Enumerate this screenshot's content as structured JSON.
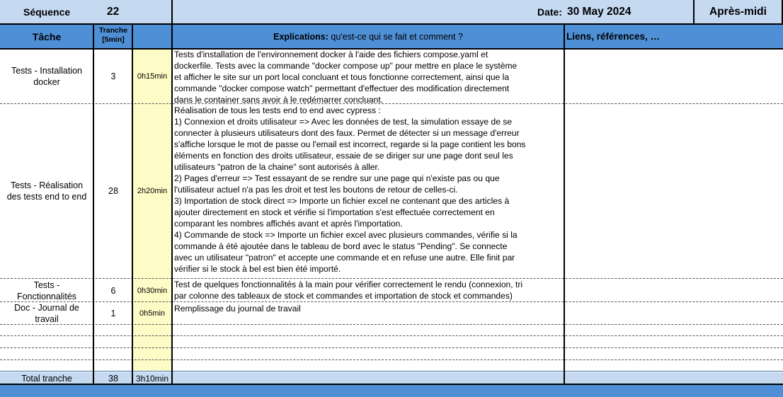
{
  "title_row": {
    "sequence_label": "Séquence",
    "sequence_value": "22",
    "date_label": "Date:",
    "date_value": "30 May 2024",
    "period": "Après-midi"
  },
  "headers": {
    "task": "Tâche",
    "tranche_line1": "Tranche",
    "tranche_line2": "[5min]",
    "explications_bold": "Explications:",
    "explications_rest": " qu'est-ce qui se fait et comment ?",
    "links": "Liens, références, …"
  },
  "rows": [
    {
      "task_lines": [
        "Tests - Installation",
        "docker"
      ],
      "tranche": "3",
      "duration": "0h15min",
      "lines": [
        "Tests d'installation de l'environnement docker à l'aide des fichiers compose.yaml et",
        "dockerfile. Tests avec la commande \"docker compose up\" pour mettre en place le système",
        "et afficher le site sur un port local concluant et tous fonctionne correctement, ainsi que la",
        "commande \"docker compose watch\" permettant d'effectuer des modification directement",
        "dans le container sans avoir à le redémarrer concluant."
      ]
    },
    {
      "task_lines": [
        "Tests - Réalisation",
        "des tests end to end"
      ],
      "tranche": "28",
      "duration": "2h20min",
      "lines": [
        "Réalisation de tous les tests end to end avec cypress :",
        "1) Connexion et droits utilisateur => Avec les données de test, la simulation essaye de se",
        "connecter à plusieurs utilisateurs dont des faux. Permet de détecter si un message d'erreur",
        "s'affiche lorsque le mot de passe ou l'email est incorrect, regarde si la page contient les bons",
        "éléments en fonction des droits utilisateur, essaie de se diriger sur une page dont seul les",
        "utilisateurs \"patron de la chaine\" sont autorisés à aller.",
        "2) Pages d'erreur => Test essayant de se rendre sur une page qui n'existe pas ou que",
        "l'utilisateur actuel n'a pas les droit et test les boutons de retour de celles-ci.",
        "3) Importation de stock direct => Importe un fichier excel ne contenant que des articles à",
        "ajouter directement en stock et vérifie si l'importation s'est effectuée correctement en",
        "comparant les nombres affichés avant et après l'importation.",
        "4) Commande de stock => Importe un fichier excel avec plusieurs commandes, vérifie si la",
        "commande à été ajoutée dans le tableau de bord avec le status \"Pending\". Se connecte",
        "avec un utilisateur \"patron\" et accepte une commande et en refuse une autre. Elle finit par",
        "vérifier si le stock à bel est bien été importé."
      ]
    },
    {
      "task_lines": [
        "Tests -",
        "Fonctionnalités"
      ],
      "tranche": "6",
      "duration": "0h30min",
      "lines": [
        "Test de quelques fonctionnalités à la main pour vérifier correctement le rendu (connexion, tri",
        "par colonne des tableaux de stock et commandes et importation de stock et commandes)"
      ]
    },
    {
      "task_lines": [
        "Doc - Journal de",
        "travail"
      ],
      "tranche": "1",
      "duration": "0h5min",
      "lines": [
        "Remplissage du journal de travail"
      ]
    }
  ],
  "total": {
    "label": "Total tranche",
    "tranche": "38",
    "duration": "3h10min"
  }
}
